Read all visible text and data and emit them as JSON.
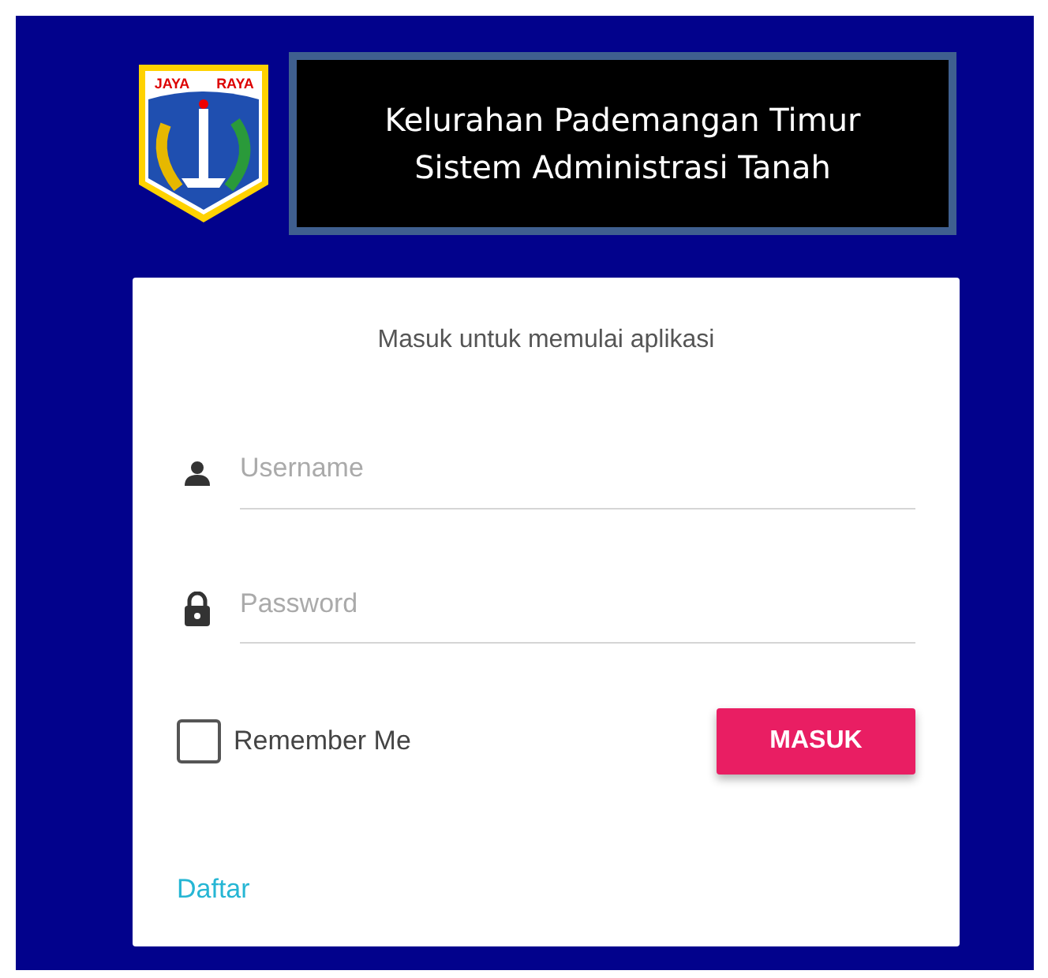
{
  "header": {
    "emblem_words": [
      "JAYA",
      "RAYA"
    ],
    "title_lines": [
      "Kelurahan Pademangan Timur",
      "Sistem Administrasi Tanah"
    ]
  },
  "login": {
    "heading": "Masuk untuk memulai aplikasi",
    "fields": [
      {
        "kind": "user",
        "placeholder": "Username"
      },
      {
        "kind": "password",
        "placeholder": "Password"
      }
    ],
    "remember": {
      "label": "Remember Me",
      "checked": false
    },
    "submit": "MASUK",
    "register_link": "Daftar"
  }
}
